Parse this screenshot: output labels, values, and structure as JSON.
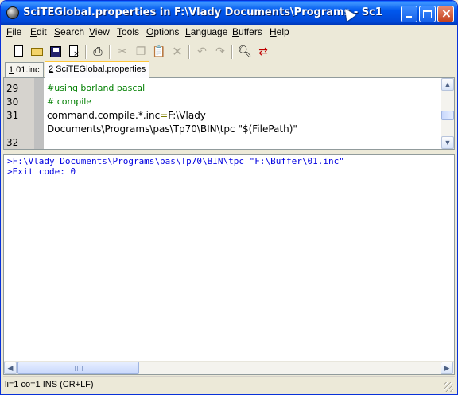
{
  "window": {
    "title": "SciTEGlobal.properties in F:\\Vlady Documents\\Programs - Sc1",
    "accent": "#0054e3"
  },
  "menu": [
    {
      "pre": "",
      "u": "F",
      "post": "ile"
    },
    {
      "pre": "",
      "u": "E",
      "post": "dit"
    },
    {
      "pre": "",
      "u": "S",
      "post": "earch"
    },
    {
      "pre": "",
      "u": "V",
      "post": "iew"
    },
    {
      "pre": "",
      "u": "T",
      "post": "ools"
    },
    {
      "pre": "",
      "u": "O",
      "post": "ptions"
    },
    {
      "pre": "",
      "u": "L",
      "post": "anguage"
    },
    {
      "pre": "",
      "u": "B",
      "post": "uffers"
    },
    {
      "pre": "",
      "u": "H",
      "post": "elp"
    }
  ],
  "toolbar_icons": [
    "new-file-icon",
    "open-folder-icon",
    "save-icon",
    "close-file-icon",
    "print-icon",
    "cut-icon",
    "copy-icon",
    "paste-icon",
    "delete-icon",
    "undo-icon",
    "redo-icon",
    "find-icon",
    "replace-icon"
  ],
  "tabs": [
    {
      "u": "1",
      "rest": " 01.inc",
      "active": false
    },
    {
      "u": "2",
      "rest": " SciTEGlobal.properties",
      "active": true
    }
  ],
  "editor": {
    "lines": [
      {
        "num": "29",
        "text": "#using borland pascal",
        "kind": "comment"
      },
      {
        "num": "30",
        "text": "# compile",
        "kind": "comment"
      },
      {
        "num": "31",
        "key": "command.compile.*.inc",
        "op": "=",
        "value": "F:\\Vlady",
        "kind": "assign"
      },
      {
        "num": "",
        "text": "Documents\\Programs\\pas\\Tp70\\BIN\\tpc \"$(FilePath)\"",
        "kind": "plain"
      },
      {
        "num": "32",
        "text": "",
        "kind": "plain"
      }
    ]
  },
  "output": {
    "lines": [
      ">F:\\Vlady Documents\\Programs\\pas\\Tp70\\BIN\\tpc \"F:\\Buffer\\01.inc\"",
      ">Exit code: 0"
    ]
  },
  "status": {
    "text": "li=1 co=1 INS (CR+LF)"
  }
}
